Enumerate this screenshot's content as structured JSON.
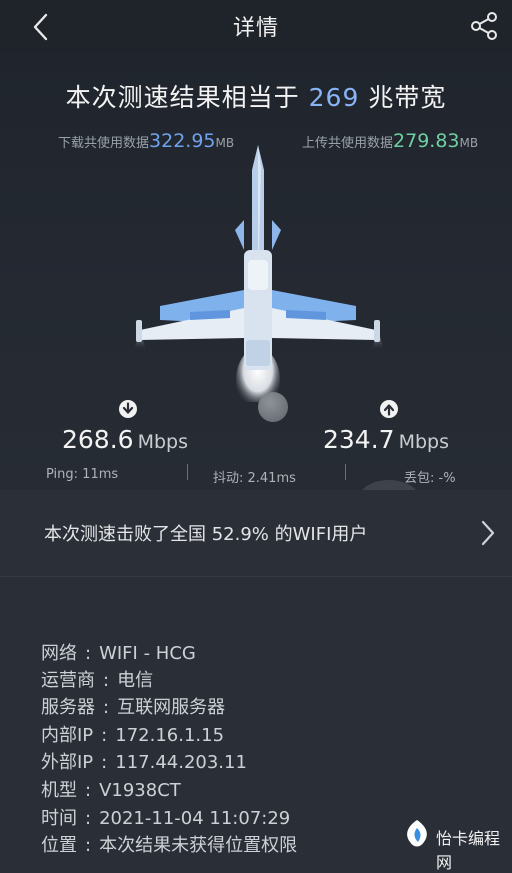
{
  "header": {
    "title": "详情",
    "back_icon": "chevron-left-icon",
    "share_icon": "share-icon"
  },
  "result": {
    "headline_prefix": "本次测速结果相当于",
    "bandwidth": "269",
    "headline_suffix": "兆带宽",
    "download_usage_label": "下载共使用数据",
    "download_usage_value": "322.95",
    "download_usage_unit": "MB",
    "upload_usage_label": "上传共使用数据",
    "upload_usage_value": "279.83",
    "upload_usage_unit": "MB",
    "download_speed": "268.6",
    "download_speed_unit": "Mbps",
    "upload_speed": "234.7",
    "upload_speed_unit": "Mbps",
    "ping": "Ping:  11ms",
    "jitter": "抖动:  2.41ms",
    "loss": "丢包:  -%"
  },
  "beat": {
    "text": "本次测速击败了全国 52.9% 的WIFI用户"
  },
  "details": [
    {
      "key": "网络",
      "value": "WIFI - HCG"
    },
    {
      "key": "运营商",
      "value": "电信"
    },
    {
      "key": "服务器",
      "value": "互联网服务器"
    },
    {
      "key": "内部IP",
      "value": "172.16.1.15"
    },
    {
      "key": "外部IP",
      "value": "117.44.203.11"
    },
    {
      "key": "机型",
      "value": "V1938CT"
    },
    {
      "key": "时间",
      "value": "2021-11-04 11:07:29"
    },
    {
      "key": "位置",
      "value": "本次结果未获得位置权限"
    }
  ],
  "watermark": {
    "text": "怡卡编程网"
  },
  "colors": {
    "accent_blue": "#6fa3ee",
    "accent_green": "#6fcfa1",
    "background": "#2a2f37"
  }
}
